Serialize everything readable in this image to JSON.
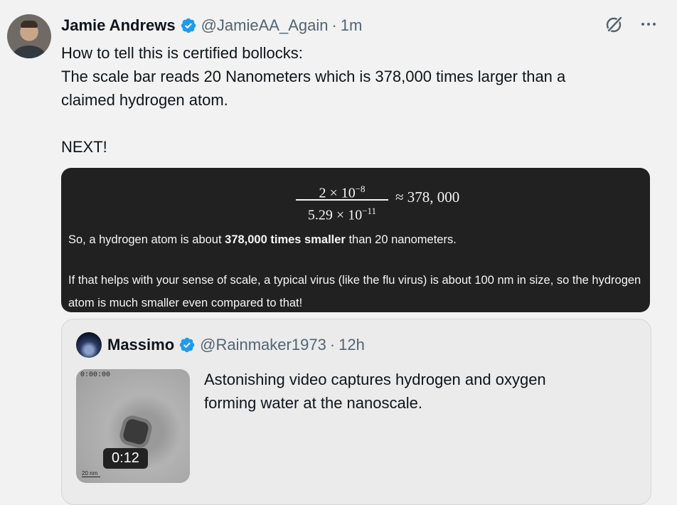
{
  "tweet": {
    "author_name": "Jamie Andrews",
    "handle": "@JamieAA_Again",
    "separator": "·",
    "time": "1m",
    "text_lines": [
      "How to tell this is certified bollocks:",
      "The scale bar reads 20 Nanometers which is 378,000 times larger than a",
      "claimed hydrogen atom.",
      "",
      "NEXT!"
    ],
    "icons": [
      "grok-icon",
      "more-icon",
      "verified-icon",
      "avatar"
    ]
  },
  "image_card": {
    "formula": {
      "numerator": "2 × 10",
      "numerator_exp": "−8",
      "denominator": "5.29 × 10",
      "denominator_exp": "−11",
      "result": "≈ 378, 000"
    },
    "line1_pre": "So, a hydrogen atom is about ",
    "line1_bold": "378,000 times smaller",
    "line1_post": " than 20 nanometers.",
    "line2": "If that helps with your sense of scale, a typical virus (like the flu virus) is about 100 nm in size, so the hydrogen atom is much smaller even compared to that!"
  },
  "quoted_tweet": {
    "author_name": "Massimo",
    "handle": "@Rainmaker1973",
    "separator": "·",
    "time": "12h",
    "text": "Astonishing video captures hydrogen and oxygen forming water at the nanoscale.",
    "video": {
      "duration": "0:12",
      "timestamp_overlay": "0:00:00",
      "scale_label": "20 nm"
    }
  }
}
